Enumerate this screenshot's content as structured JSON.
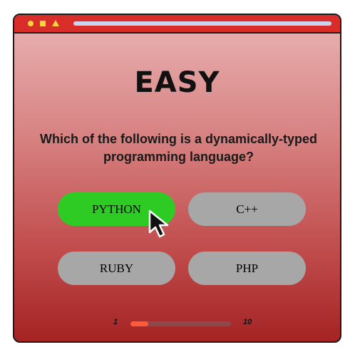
{
  "window": {
    "controls": [
      "circle",
      "square",
      "triangle"
    ],
    "accent_color": "#d92d2a",
    "control_color": "#ffd23f"
  },
  "quiz": {
    "level": "EASY",
    "question": "Which of the following  is a dynamically-typed programming language?",
    "options": [
      {
        "label": "PYTHON",
        "selected": true
      },
      {
        "label": "C++",
        "selected": false
      },
      {
        "label": "RUBY",
        "selected": false
      },
      {
        "label": "PHP",
        "selected": false
      }
    ],
    "selected_color": "#2ecb24",
    "option_color": "#a7a7a7"
  },
  "progress": {
    "start_label": "1",
    "end_label": "10",
    "current": 1,
    "total": 10,
    "fraction": 0.18,
    "fill_color": "#ff5a3a"
  },
  "cursor": {
    "icon": "mouse-pointer-icon"
  }
}
